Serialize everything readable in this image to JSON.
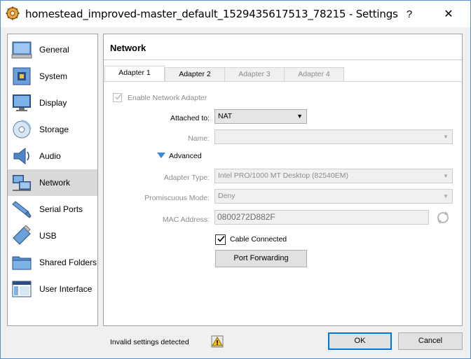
{
  "window": {
    "title": "homestead_improved-master_default_1529435617513_78215 - Settings",
    "help_glyph": "?",
    "close_glyph": "✕"
  },
  "sidebar": {
    "items": [
      {
        "label": "General",
        "icon": "general-icon",
        "selected": false
      },
      {
        "label": "System",
        "icon": "system-icon",
        "selected": false
      },
      {
        "label": "Display",
        "icon": "display-icon",
        "selected": false
      },
      {
        "label": "Storage",
        "icon": "storage-icon",
        "selected": false
      },
      {
        "label": "Audio",
        "icon": "audio-icon",
        "selected": false
      },
      {
        "label": "Network",
        "icon": "network-icon",
        "selected": true
      },
      {
        "label": "Serial Ports",
        "icon": "serial-ports-icon",
        "selected": false
      },
      {
        "label": "USB",
        "icon": "usb-icon",
        "selected": false
      },
      {
        "label": "Shared Folders",
        "icon": "shared-folders-icon",
        "selected": false
      },
      {
        "label": "User Interface",
        "icon": "user-interface-icon",
        "selected": false
      }
    ]
  },
  "main": {
    "section_title": "Network",
    "tabs": [
      {
        "label": "Adapter 1",
        "state": "active"
      },
      {
        "label": "Adapter 2",
        "state": "enabled"
      },
      {
        "label": "Adapter 3",
        "state": "disabled"
      },
      {
        "label": "Adapter 4",
        "state": "disabled"
      }
    ],
    "enable_adapter": {
      "label": "Enable Network Adapter",
      "checked": true,
      "disabled": true
    },
    "attached_to": {
      "label": "Attached to:",
      "value": "NAT"
    },
    "name": {
      "label": "Name:",
      "value": ""
    },
    "advanced": {
      "label": "Advanced",
      "expanded": true
    },
    "adapter_type": {
      "label": "Adapter Type:",
      "value": "Intel PRO/1000 MT Desktop (82540EM)"
    },
    "promiscuous_mode": {
      "label": "Promiscuous Mode:",
      "value": "Deny"
    },
    "mac_address": {
      "label": "MAC Address:",
      "value": "0800272D882F"
    },
    "cable_connected": {
      "label": "Cable Connected",
      "checked": true
    },
    "port_forwarding_label": "Port Forwarding"
  },
  "footer": {
    "status": "Invalid settings detected",
    "ok_label": "OK",
    "cancel_label": "Cancel"
  },
  "colors": {
    "window_border": "#5e8fbf",
    "selected_item_bg": "#d9d9d9",
    "primary_button_border": "#0078d7",
    "disabled_text": "#8c8c8c"
  }
}
